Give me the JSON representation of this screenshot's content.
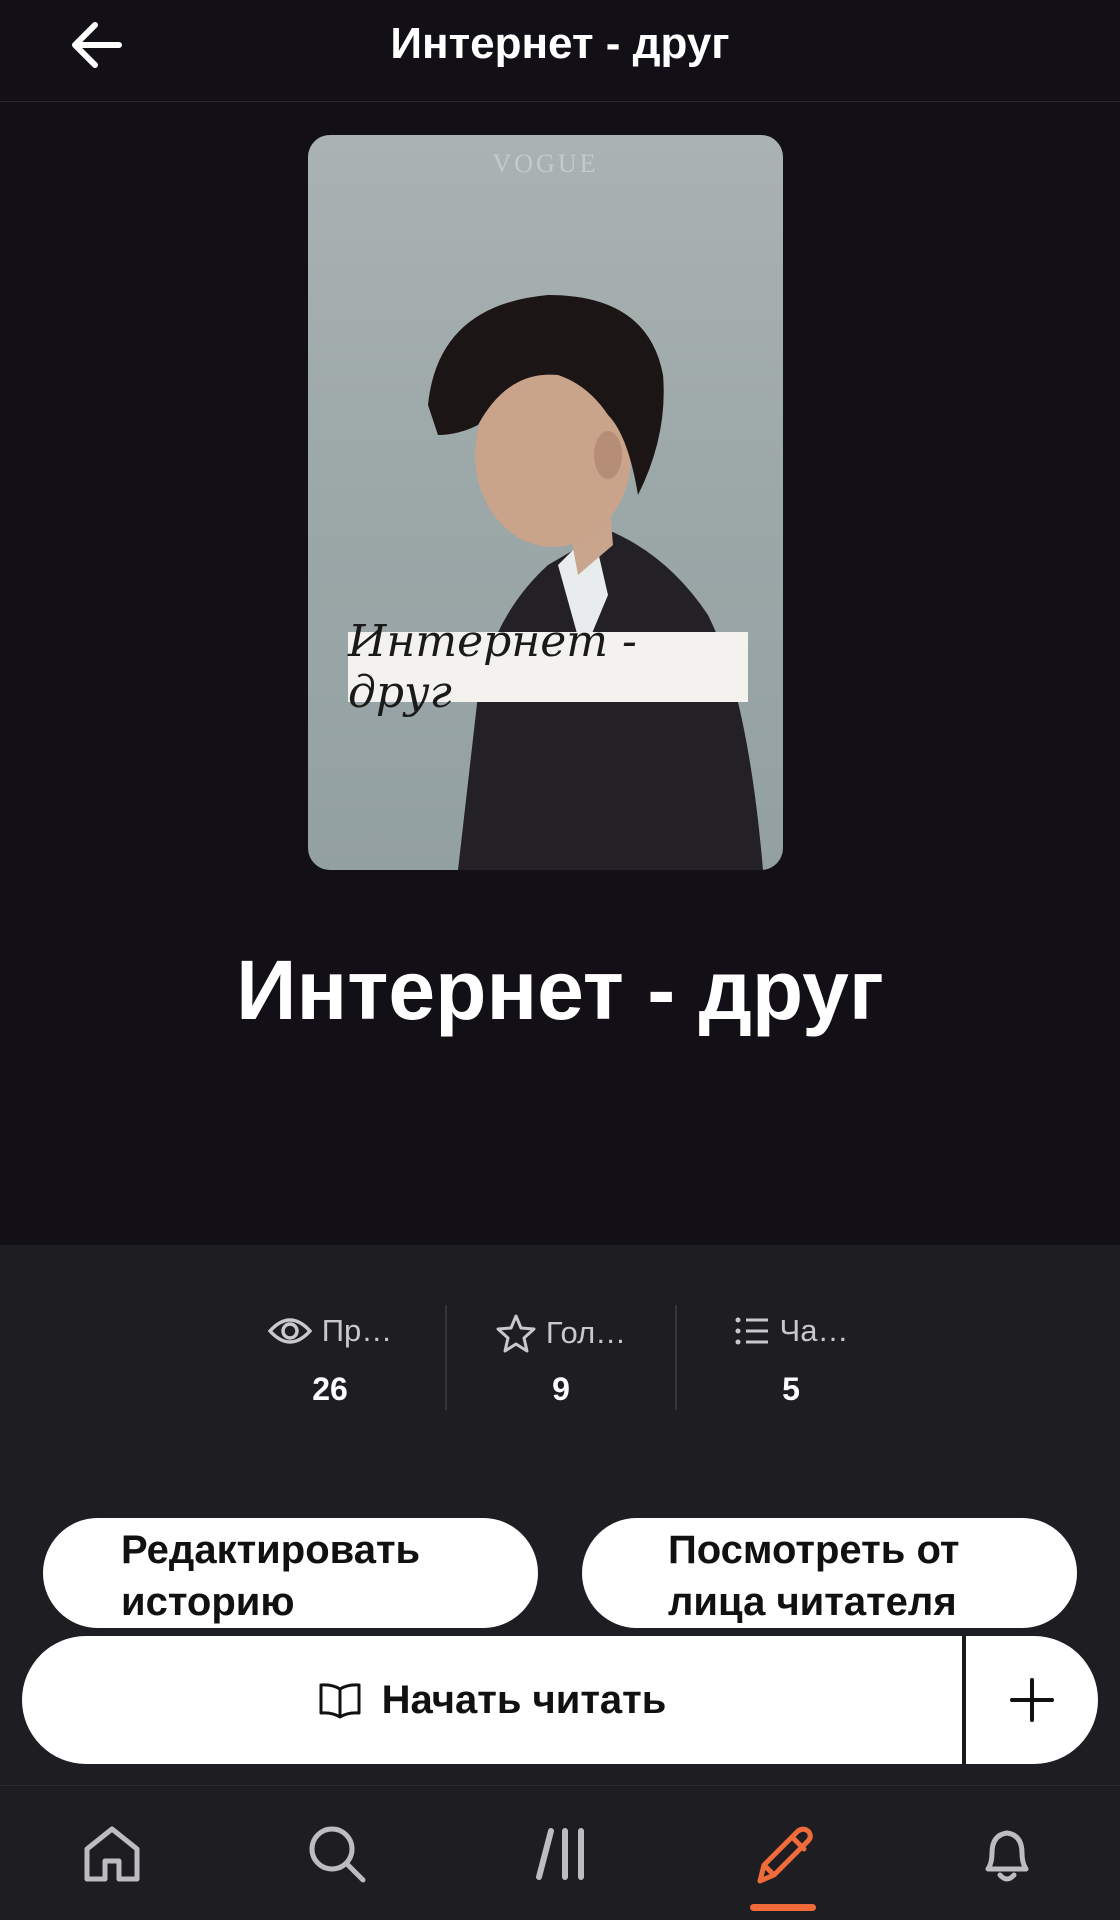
{
  "header": {
    "title": "Интернет - друг",
    "back_icon": "arrow-left-icon"
  },
  "cover": {
    "magazine_text": "VOGUE",
    "label_text": "Интернет - друг"
  },
  "story": {
    "title": "Интернет - друг"
  },
  "stats": [
    {
      "icon": "eye-icon",
      "label": "Пр…",
      "value": "26"
    },
    {
      "icon": "star-icon",
      "label": "Гол…",
      "value": "9"
    },
    {
      "icon": "list-icon",
      "label": "Ча…",
      "value": "5"
    }
  ],
  "actions": {
    "edit_line1": "Редактировать",
    "edit_line2": "историю",
    "view_line1": "Посмотреть от",
    "view_line2": "лица читателя",
    "start_reading": "Начать читать",
    "add_icon": "plus-icon"
  },
  "bottom_nav": {
    "items": [
      "home-icon",
      "search-icon",
      "library-icon",
      "write-icon",
      "bell-icon"
    ],
    "active": "write-icon",
    "accent_color": "#ef6b3a"
  }
}
